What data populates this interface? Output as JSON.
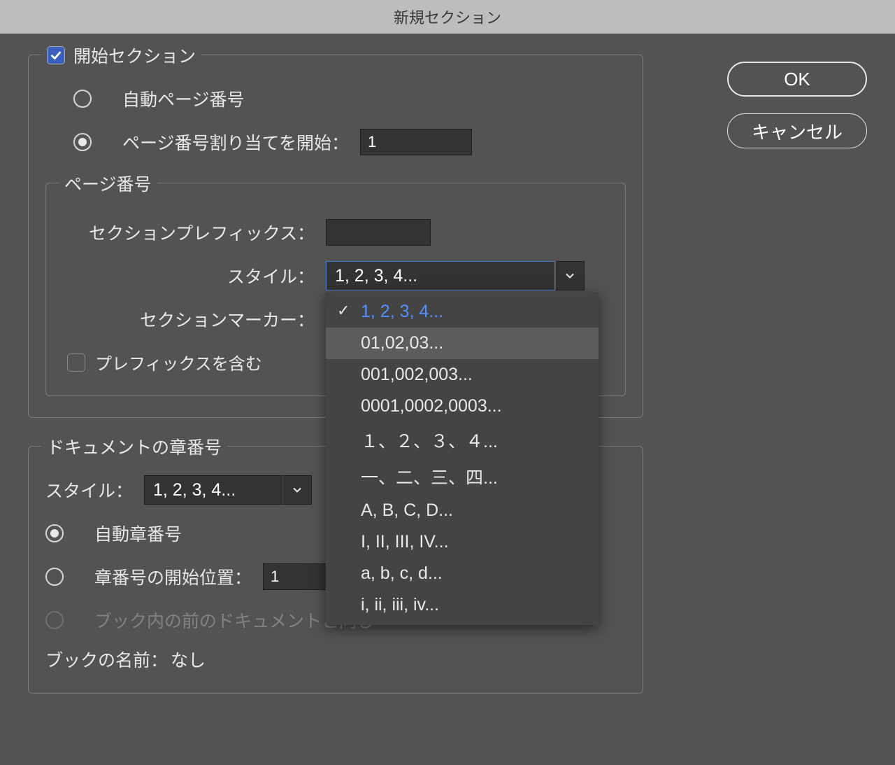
{
  "title": "新規セクション",
  "section_panel": {
    "legend": "開始セクション",
    "auto_page": "自動ページ番号",
    "start_page": "ページ番号割り当てを開始：",
    "start_page_value": "1",
    "page_number_group": {
      "legend": "ページ番号",
      "prefix_label": "セクションプレフィックス：",
      "prefix_value": "",
      "style_label": "スタイル：",
      "style_value": "1, 2, 3, 4...",
      "marker_label": "セクションマーカー：",
      "include_prefix": "プレフィックスを含む"
    }
  },
  "style_dropdown_items": [
    "1, 2, 3, 4...",
    "01,02,03...",
    "001,002,003...",
    "0001,0002,0003...",
    "１、２、３、４...",
    "一、二、三、四...",
    "A, B, C, D...",
    "I, II, III, IV...",
    "a, b, c, d...",
    "i, ii, iii, iv..."
  ],
  "chapter_panel": {
    "legend": "ドキュメントの章番号",
    "style_label": "スタイル：",
    "style_value": "1, 2, 3, 4...",
    "auto_chapter": "自動章番号",
    "start_chapter": "章番号の開始位置：",
    "start_chapter_value": "1",
    "same_as_prev": "ブック内の前のドキュメントと同じ",
    "book_name_label": "ブックの名前：",
    "book_name_value": "なし"
  },
  "buttons": {
    "ok": "OK",
    "cancel": "キャンセル"
  }
}
